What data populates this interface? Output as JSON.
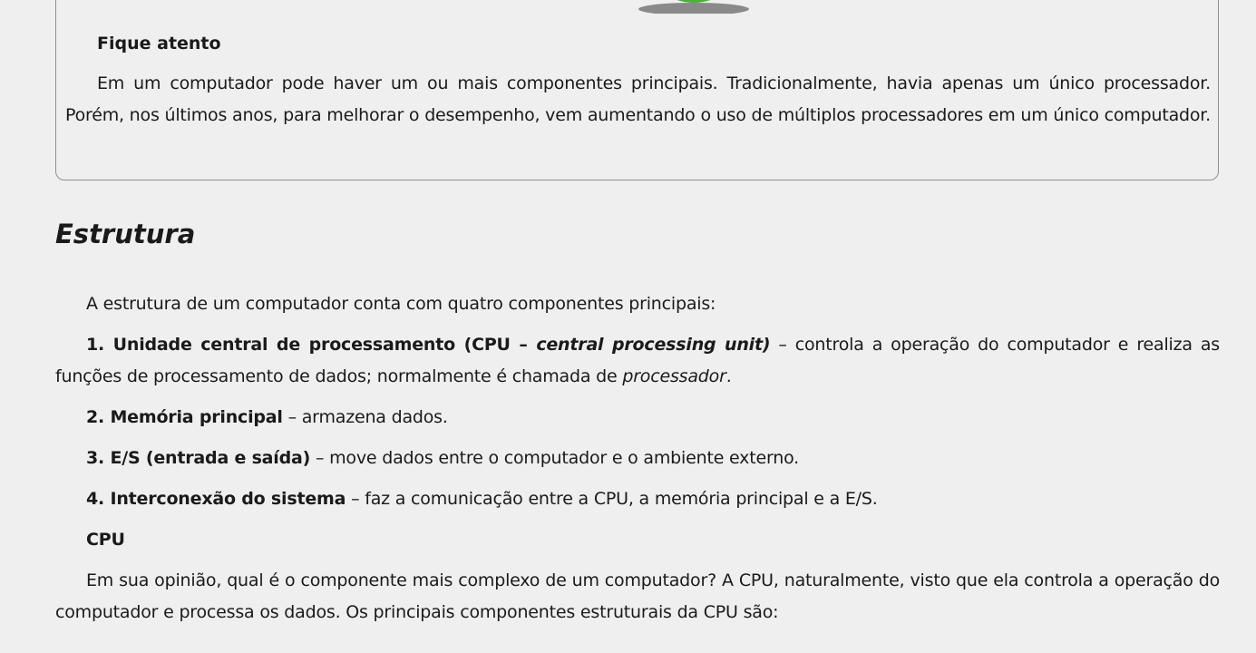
{
  "callout": {
    "title": "Fique atento",
    "text": "Em um computador pode haver um ou mais componentes principais. Tradicionalmente, havia apenas um único processador. Porém, nos últimos anos, para melhorar o desempenho, vem aumentando o uso de múltiplos processadores em um único computador."
  },
  "section": {
    "title": "Estrutura",
    "intro": "A estrutura de um computador conta com quatro componentes principais:",
    "items": [
      {
        "label": "1. Unidade central de processamento (CPU – ",
        "label_em": "central processing unit)",
        "text": " – controla a operação do computador e realiza as funções de processamento de dados; normalmente é chamada de ",
        "text_em": "processador",
        "text_end": "."
      },
      {
        "label": "2. Memória principal",
        "text": " – armazena dados."
      },
      {
        "label": "3. E/S (entrada e saída)",
        "text": " – move dados entre o computador e o ambiente externo."
      },
      {
        "label": "4. Interconexão do sistema",
        "text": " – faz a comunicação entre a CPU, a memória principal e a E/S."
      }
    ],
    "subheading": "CPU",
    "cpu_paragraph": "Em sua opinião, qual é o componente mais complexo de um computador? A CPU, naturalmente, visto que ela controla a operação do computador e processa os dados. Os principais componentes estruturais da CPU são:"
  },
  "colors": {
    "background": "#efefef",
    "text": "#1a1a1a",
    "box_border": "#8f8f8f",
    "ball_green": "#4caf3c",
    "shadow": "#8a8a8a"
  }
}
